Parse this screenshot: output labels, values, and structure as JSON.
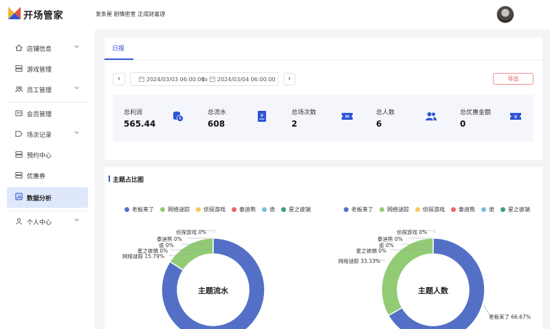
{
  "header": {
    "brand": "开场管家",
    "breadcrumb": "发条屋 剧情密室 正成财富店",
    "colors": {
      "accent": "#2f55d4"
    }
  },
  "sidebar": {
    "items": [
      {
        "label": "店铺信息",
        "icon": "home-icon",
        "expandable": true
      },
      {
        "label": "游戏管理",
        "icon": "storage-icon",
        "expandable": false
      },
      {
        "label": "员工管理",
        "icon": "users-icon",
        "expandable": true
      },
      {
        "label": "会员管理",
        "icon": "member-card-icon",
        "expandable": false
      },
      {
        "label": "场次记录",
        "icon": "tag-icon",
        "expandable": true
      },
      {
        "label": "预约中心",
        "icon": "storage-icon",
        "expandable": false
      },
      {
        "label": "优惠券",
        "icon": "storage-icon",
        "expandable": false
      },
      {
        "label": "数据分析",
        "icon": "chart-icon",
        "expandable": false,
        "active": true
      },
      {
        "label": "个人中心",
        "icon": "user-icon",
        "expandable": true
      }
    ]
  },
  "report": {
    "tab": "日报",
    "date_start": "2024/03/03 06:00:00",
    "date_sep": "to",
    "date_end": "2024/03/04 06:00:00",
    "export_label": "导出",
    "stats": [
      {
        "label": "总利润",
        "value": "565.44",
        "icon": "coins-icon"
      },
      {
        "label": "总流水",
        "value": "608",
        "icon": "receipt-icon"
      },
      {
        "label": "总场次数",
        "value": "2",
        "icon": "ticket-icon"
      },
      {
        "label": "总人数",
        "value": "6",
        "icon": "users-icon"
      },
      {
        "label": "总优惠金额",
        "value": "0",
        "icon": "discount-ticket-icon"
      }
    ]
  },
  "theme_chart": {
    "section_title": "主题占比图",
    "legend": [
      {
        "name": "老板来了",
        "color": "#5470c6"
      },
      {
        "name": "网络谜踪",
        "color": "#91cc75"
      },
      {
        "name": "侦探游戏",
        "color": "#fac858"
      },
      {
        "name": "泰迪熊",
        "color": "#ee6666"
      },
      {
        "name": "诡",
        "color": "#73c0de"
      },
      {
        "name": "星之彼端",
        "color": "#3ba272"
      }
    ]
  },
  "chart_data": [
    {
      "type": "pie",
      "title": "主题流水",
      "categories": [
        "老板来了",
        "网络谜踪",
        "侦探游戏",
        "泰迪熊",
        "诡",
        "星之彼端"
      ],
      "values": [
        84.21,
        15.79,
        0,
        0,
        0,
        0
      ],
      "label_texts": [
        "",
        "网络谜踪 15.79%",
        "侦探游戏 0%",
        "泰迪熊 0%",
        "诡 0%",
        "星之彼端 0%"
      ]
    },
    {
      "type": "pie",
      "title": "主题人数",
      "categories": [
        "老板来了",
        "网络谜踪",
        "侦探游戏",
        "泰迪熊",
        "诡",
        "星之彼端"
      ],
      "values": [
        66.67,
        33.33,
        0,
        0,
        0,
        0
      ],
      "label_texts": [
        "老板来了 66.67%",
        "网络谜踪 33.33%",
        "侦探游戏 0%",
        "泰迪熊 0%",
        "诡 0%",
        "星之彼端 0%"
      ]
    }
  ]
}
